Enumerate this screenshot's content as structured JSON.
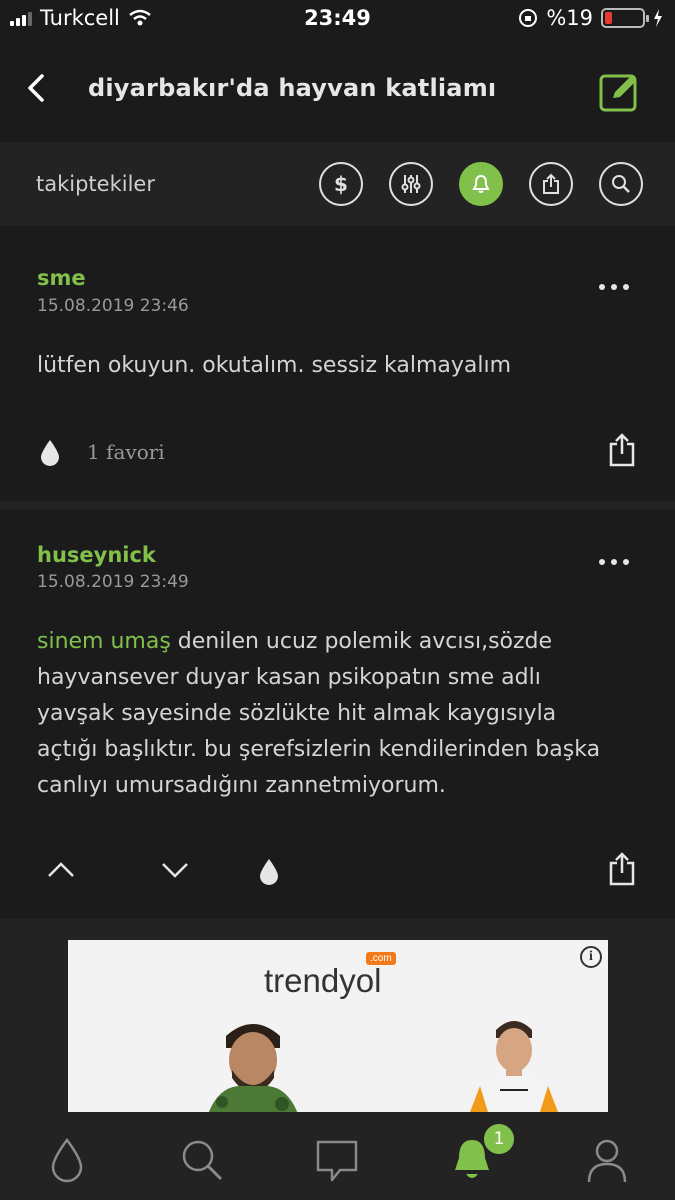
{
  "status_bar": {
    "carrier": "Turkcell",
    "time": "23:49",
    "battery": "%19",
    "battery_level": 0.19
  },
  "header": {
    "title": "diyarbakır'da hayvan katliamı"
  },
  "toolbar": {
    "label": "takiptekiler"
  },
  "entries": [
    {
      "author": "sme",
      "date": "15.08.2019 23:46",
      "content": "lütfen okuyun. okutalım. sessiz kalmayalım",
      "favorites": "1 favori"
    },
    {
      "author": "huseynick",
      "date": "15.08.2019 23:49",
      "link": "sinem umaş",
      "content": " denilen ucuz polemik avcısı,sözde hayvansever duyar kasan psikopatın sme adlı yavşak sayesinde sözlükte hit almak kaygısıyla açtığı başlıktır. bu şerefsizlerin kendilerinden başka canlıyı umursadığını zannetmiyorum."
    }
  ],
  "ad": {
    "logo": "trendyol",
    "com": ".com"
  },
  "tabbar": {
    "notification_badge": "1"
  },
  "colors": {
    "accent": "#81c14b",
    "background": "#1b1b1b",
    "battery_low": "#e53b30"
  }
}
